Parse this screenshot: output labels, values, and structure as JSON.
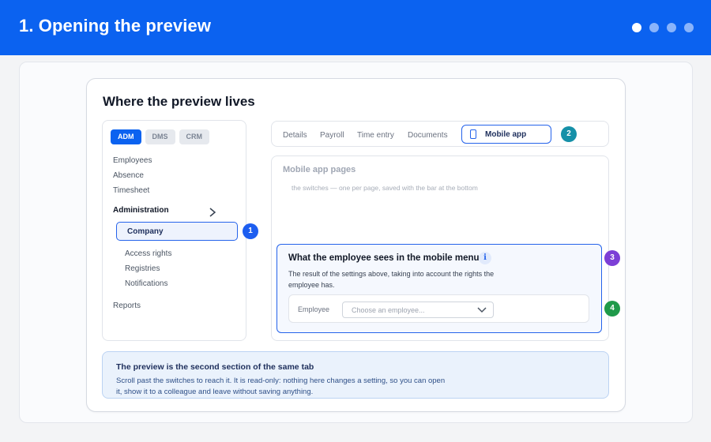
{
  "header": {
    "title": "1. Opening the preview",
    "steps": [
      true,
      false,
      false,
      false
    ]
  },
  "card": {
    "title": "Where the preview lives"
  },
  "sidebar": {
    "modules": [
      "ADM",
      "DMS",
      "CRM"
    ],
    "items": [
      "Employees",
      "Absence",
      "Timesheet"
    ],
    "section": "Administration",
    "selected": "Company",
    "subitems": [
      "Access rights",
      "Registries",
      "Notifications"
    ],
    "footer_item": "Reports"
  },
  "tabs": {
    "items": [
      "Details",
      "Payroll",
      "Time entry",
      "Documents"
    ],
    "active": "Mobile app"
  },
  "pages_panel": {
    "title": "Mobile app pages",
    "subtitle": "the switches — one per page, saved with the bar at the bottom"
  },
  "preview": {
    "title": "What the employee sees in the mobile menu",
    "info_icon": "i",
    "description": "The result of the settings above, taking into account the rights the employee has.",
    "employee_label": "Employee",
    "employee_placeholder": "Choose an employee..."
  },
  "badges": [
    "1",
    "2",
    "3",
    "4"
  ],
  "badge_colors": {
    "1": "#1d5ef0",
    "2": "#1590a8",
    "3": "#7c3fd6",
    "4": "#1f9a4a"
  },
  "note": {
    "title": "The preview is the second section of the same tab",
    "body": "Scroll past the switches to reach it. It is read-only: nothing here changes a setting, so you can open it, show it to a colleague and leave without saving anything."
  }
}
